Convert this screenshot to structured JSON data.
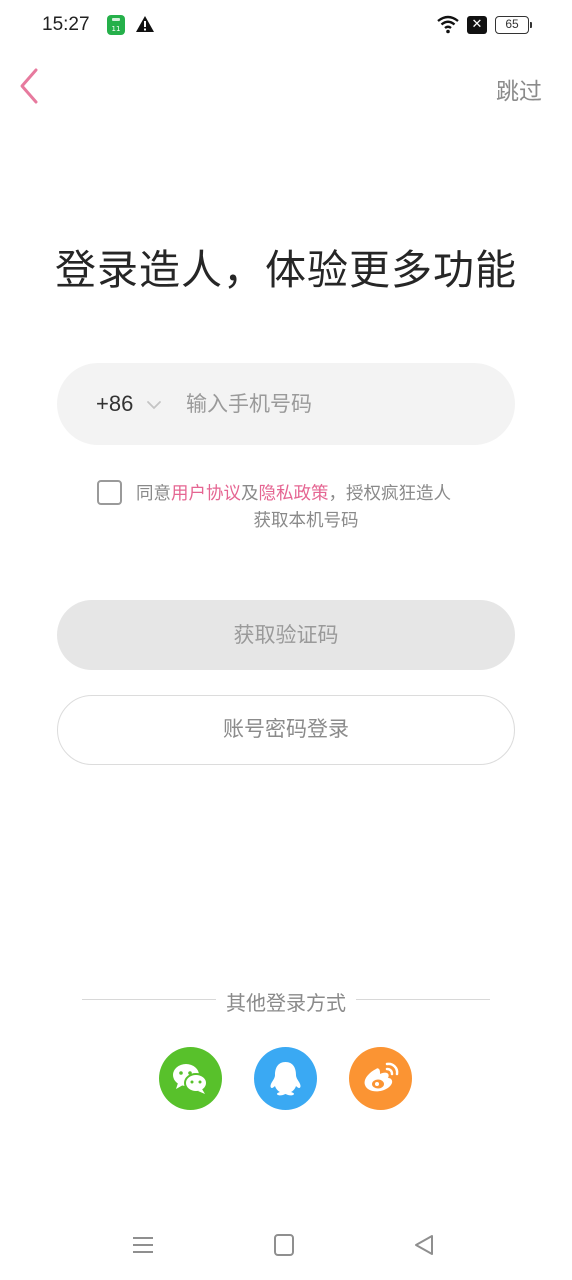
{
  "status_bar": {
    "time": "15:27",
    "battery": "65",
    "icons": [
      "app-notification-icon",
      "warning-icon",
      "wifi-icon",
      "no-sim-icon",
      "battery-icon"
    ]
  },
  "header": {
    "skip_label": "跳过"
  },
  "title": "登录造人，体验更多功能",
  "phone": {
    "country_code": "+86",
    "placeholder": "输入手机号码",
    "value": ""
  },
  "agreement": {
    "prefix": "同意",
    "user_agreement": "用户协议",
    "and": "及",
    "privacy_policy": "隐私政策",
    "suffix": "，授权疯狂造人",
    "line2": "获取本机号码",
    "checked": false
  },
  "buttons": {
    "get_code": "获取验证码",
    "password_login": "账号密码登录"
  },
  "other_login": {
    "label": "其他登录方式",
    "providers": [
      "wechat",
      "qq",
      "weibo"
    ]
  },
  "colors": {
    "accent": "#e56592",
    "wechat": "#58c12b",
    "qq": "#3aa9f3",
    "weibo": "#fb9433"
  }
}
